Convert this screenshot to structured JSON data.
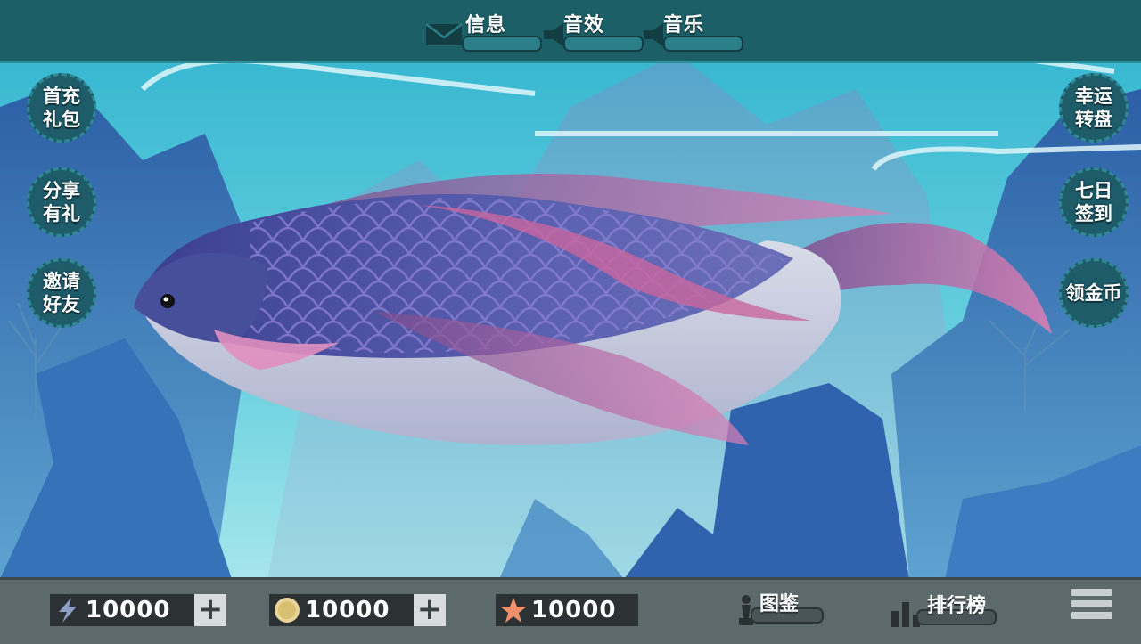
{
  "top_menu": {
    "message_label": "信息",
    "sound_label": "音效",
    "music_label": "音乐"
  },
  "left_buttons": [
    {
      "label": "首充礼包"
    },
    {
      "label": "分享有礼"
    },
    {
      "label": "邀请好友"
    }
  ],
  "right_buttons": [
    {
      "label": "幸运转盘"
    },
    {
      "label": "七日签到"
    },
    {
      "label": "领金币"
    }
  ],
  "resources": {
    "energy": "10000",
    "coins": "10000",
    "stars": "10000"
  },
  "bottom_menu": {
    "codex_label": "图鉴",
    "ranking_label": "排行榜"
  },
  "icons": [
    "mail-icon",
    "speaker-icon",
    "lightning-icon",
    "coin-icon",
    "star-icon",
    "chess-icon",
    "bar-chart-icon",
    "hamburger-icon"
  ],
  "colors": {
    "top_bar": "#1d5f66",
    "bottom_bar": "#5d6a6c",
    "water": "#4fc1d6",
    "fish_body": "#4a4fa0",
    "fish_fin": "#c36fa5"
  }
}
